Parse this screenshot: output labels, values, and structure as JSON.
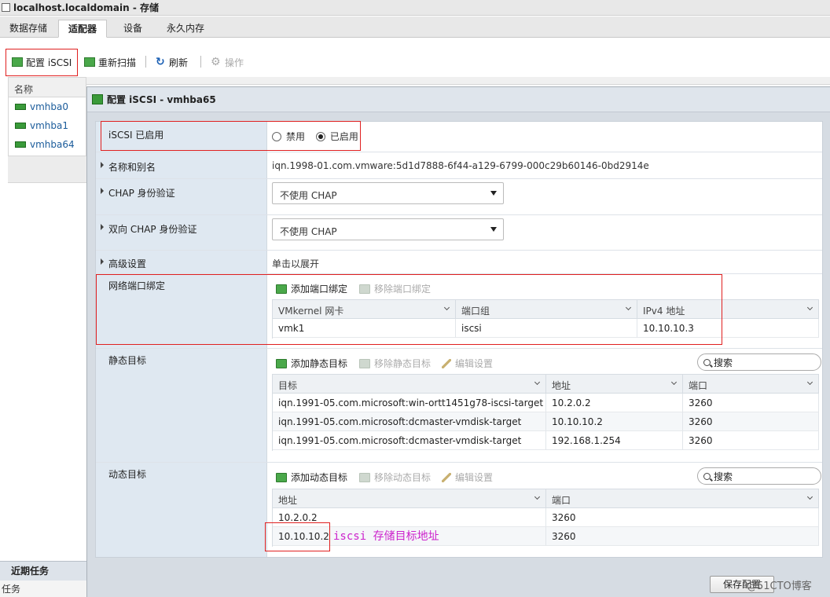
{
  "window": {
    "title": "localhost.localdomain - 存储"
  },
  "tabs": [
    "数据存储",
    "适配器",
    "设备",
    "永久内存"
  ],
  "toolbar": {
    "configure": "配置 iSCSI",
    "rescan": "重新扫描",
    "refresh": "刷新",
    "actions": "操作"
  },
  "left_panel": {
    "header": "名称",
    "items": [
      "vmhba0",
      "vmhba1",
      "vmhba64"
    ]
  },
  "recent_tasks": {
    "title": "近期任务",
    "sub": "任务"
  },
  "dialog": {
    "title": "配置 iSCSI - vmhba65",
    "iscsi_enabled": {
      "label": "iSCSI 已启用",
      "options": [
        "禁用",
        "已启用"
      ],
      "selected": "已启用"
    },
    "name_alias": {
      "label": "名称和别名",
      "value": "iqn.1998-01.com.vmware:5d1d7888-6f44-a129-6799-000c29b60146-0bd2914e"
    },
    "chap": {
      "label": "CHAP 身份验证",
      "value": "不使用 CHAP"
    },
    "mutual_chap": {
      "label": "双向 CHAP 身份验证",
      "value": "不使用 CHAP"
    },
    "advanced": {
      "label": "高级设置",
      "value": "单击以展开"
    },
    "port_binding": {
      "label": "网络端口绑定",
      "add": "添加端口绑定",
      "remove": "移除端口绑定",
      "columns": [
        "VMkernel 网卡",
        "端口组",
        "IPv4 地址"
      ],
      "rows": [
        [
          "vmk1",
          "iscsi",
          "10.10.10.3"
        ]
      ]
    },
    "static_targets": {
      "label": "静态目标",
      "add": "添加静态目标",
      "remove": "移除静态目标",
      "edit": "编辑设置",
      "search": "搜索",
      "columns": [
        "目标",
        "地址",
        "端口"
      ],
      "rows": [
        [
          "iqn.1991-05.com.microsoft:win-ortt1451g78-iscsi-target",
          "10.2.0.2",
          "3260"
        ],
        [
          "iqn.1991-05.com.microsoft:dcmaster-vmdisk-target",
          "10.10.10.2",
          "3260"
        ],
        [
          "iqn.1991-05.com.microsoft:dcmaster-vmdisk-target",
          "192.168.1.254",
          "3260"
        ]
      ]
    },
    "dynamic_targets": {
      "label": "动态目标",
      "add": "添加动态目标",
      "remove": "移除动态目标",
      "edit": "编辑设置",
      "search": "搜索",
      "columns": [
        "地址",
        "端口"
      ],
      "rows": [
        [
          "10.2.0.2",
          "3260"
        ],
        [
          "10.10.10.2",
          "3260"
        ]
      ]
    },
    "annotation": "iscsi 存储目标地址",
    "save_button": "保存配置"
  },
  "watermark": "@51CTO博客"
}
